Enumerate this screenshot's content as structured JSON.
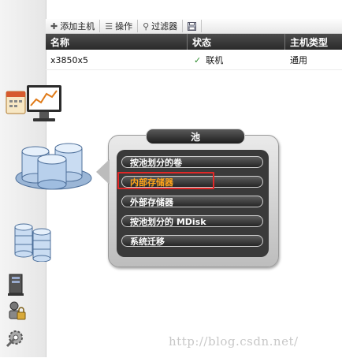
{
  "toolbar": {
    "add_host": "添加主机",
    "actions": "操作",
    "filter": "过滤器"
  },
  "grid": {
    "headers": [
      "名称",
      "状态",
      "主机类型"
    ],
    "rows": [
      {
        "name": "x3850x5",
        "status": "联机",
        "type": "通用"
      }
    ]
  },
  "pool_menu": {
    "title": "池",
    "items": [
      "按池划分的卷",
      "内部存储器",
      "外部存储器",
      "按池划分的 MDisk",
      "系统迁移"
    ],
    "active_item": "内部存储器",
    "active_color": "#ffa31a"
  },
  "watermark": "http://blog.csdn.net/",
  "icons": {
    "rail": [
      "monitoring-icon",
      "pools-icon",
      "volumes-icon",
      "hosts-icon",
      "access-icon",
      "settings-icon"
    ]
  }
}
